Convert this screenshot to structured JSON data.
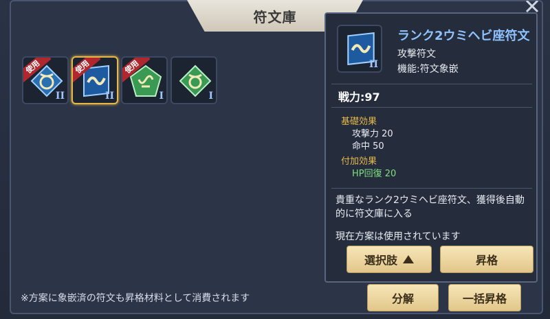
{
  "window": {
    "title": "符文庫"
  },
  "slots": [
    {
      "badge": "使用",
      "tier": "II",
      "color": "#2a6fb0",
      "icon": "horn-rune-icon"
    },
    {
      "badge": "使用",
      "tier": "II",
      "color": "#2a6fb0",
      "icon": "serpent-rune-icon"
    },
    {
      "badge": "使用",
      "tier": "I",
      "color": "#3a9a54",
      "icon": "wave-rune-icon"
    },
    {
      "badge": "",
      "tier": "I",
      "color": "#3a9a54",
      "icon": "horn-rune-icon"
    }
  ],
  "footer": {
    "note": "※方案に象嵌済の符文も昇格材料として消費されます"
  },
  "buttons": {
    "decompose": "分解",
    "bulk_upgrade": "一括昇格",
    "select": "選択肢",
    "upgrade": "昇格"
  },
  "tooltip": {
    "name": "ランク2ウミヘビ座符文",
    "tier": "II",
    "type": "攻撃符文",
    "function": "機能:符文象嵌",
    "power": "戦力:97",
    "base_title": "基礎効果",
    "base_lines": [
      "攻撃力  20",
      "命中  50"
    ],
    "extra_title": "付加効果",
    "extra_lines": [
      "HP回復  20"
    ],
    "description": "貴重なランク2ウミヘビ座符文、獲得後自動的に符文庫に入る",
    "status": "現在方案は使用されています"
  },
  "colors": {
    "accent_gold": "#e6b84a",
    "name_blue": "#8ec3ff",
    "effect_green": "#7fe07f"
  }
}
